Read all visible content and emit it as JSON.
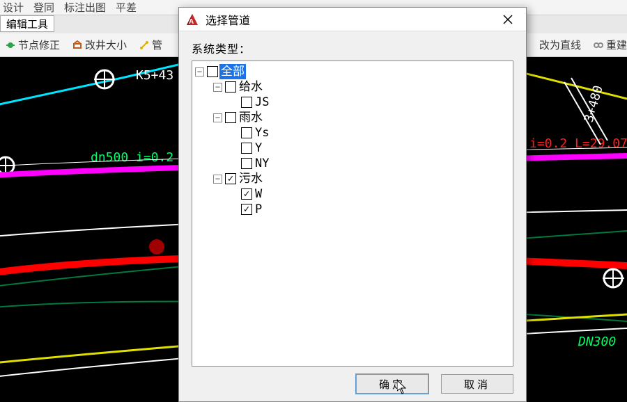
{
  "topmenu": {
    "items": [
      "设计",
      "登同",
      "标注出图",
      "平差"
    ]
  },
  "panel": {
    "label": "编辑工具"
  },
  "toolbar": {
    "node_fix": "节点修正",
    "resize_well": "改井大小",
    "pipe_tool": "管",
    "to_line": "改为直线",
    "rebuild": "重建"
  },
  "cad": {
    "top_label": "K5+43",
    "left_label": "dn500 i=0.2",
    "right_label_i": "i=0.2 L=29.07",
    "right_label_dn": "DN300",
    "station_label": "3+480"
  },
  "dialog": {
    "title": "选择管道",
    "body_label": "系统类型：",
    "buttons": {
      "ok": "确定",
      "cancel": "取消"
    }
  },
  "tree": {
    "root": {
      "label": "全部",
      "checked": false,
      "expanded": true,
      "selected": true,
      "children": [
        {
          "label": "给水",
          "checked": false,
          "expanded": true,
          "children": [
            {
              "label": "JS",
              "checked": false
            }
          ]
        },
        {
          "label": "雨水",
          "checked": false,
          "expanded": true,
          "children": [
            {
              "label": "Ys",
              "checked": false
            },
            {
              "label": "Y",
              "checked": false
            },
            {
              "label": "NY",
              "checked": false
            }
          ]
        },
        {
          "label": "污水",
          "checked": true,
          "expanded": true,
          "children": [
            {
              "label": "W",
              "checked": true
            },
            {
              "label": "P",
              "checked": true
            }
          ]
        }
      ]
    }
  },
  "colors": {
    "cyan": "#00e5ff",
    "green": "#00ff66",
    "magenta": "#ff00ff",
    "red": "#ff0000",
    "yellow": "#e0e000",
    "white": "#ffffff"
  }
}
